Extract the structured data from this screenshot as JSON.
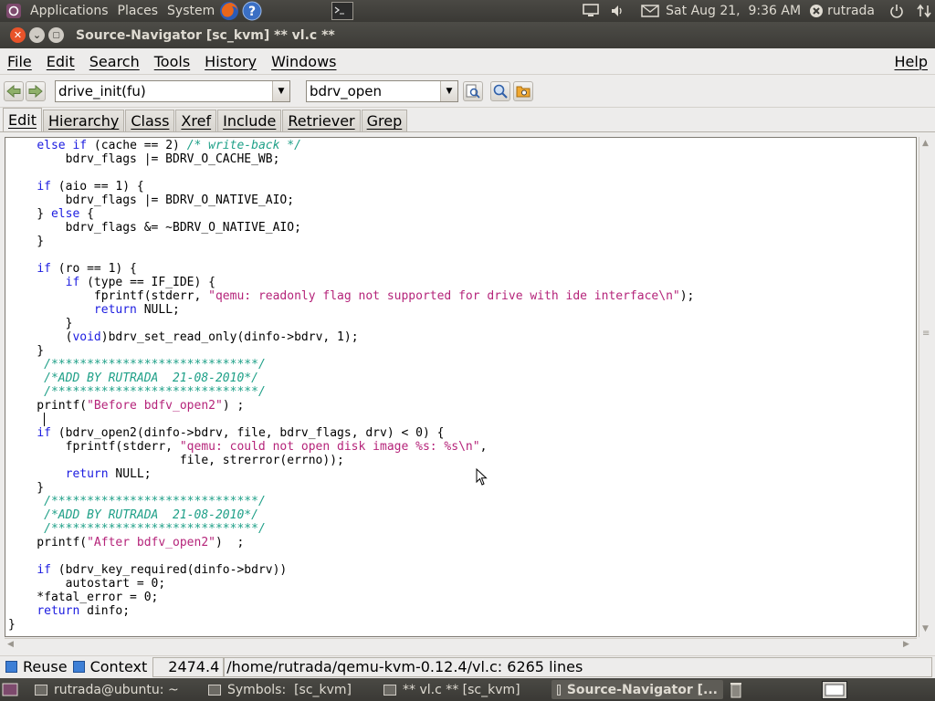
{
  "panel": {
    "menus": [
      "Applications",
      "Places",
      "System"
    ],
    "datetime": "Sat Aug 21,  9:36 AM",
    "user": "rutrada"
  },
  "window": {
    "title": "Source-Navigator [sc_kvm] ** vl.c **"
  },
  "menubar": {
    "items": [
      "File",
      "Edit",
      "Search",
      "Tools",
      "History",
      "Windows"
    ],
    "help": "Help"
  },
  "toolbar": {
    "symbol_combo": "drive_init(fu)",
    "search_combo": "bdrv_open"
  },
  "tabs": [
    "Edit",
    "Hierarchy",
    "Class",
    "Xref",
    "Include",
    "Retriever",
    "Grep"
  ],
  "active_tab": "Edit",
  "code_lines": [
    [
      [
        "    ",
        ""
      ],
      [
        "else if",
        "kw"
      ],
      [
        " (cache == 2) ",
        ""
      ],
      [
        "/* write-back */",
        "com"
      ]
    ],
    [
      [
        "        bdrv_flags |= BDRV_O_CACHE_WB;",
        ""
      ]
    ],
    [
      [
        "",
        ""
      ]
    ],
    [
      [
        "    ",
        ""
      ],
      [
        "if",
        "kw"
      ],
      [
        " (aio == 1) {",
        ""
      ]
    ],
    [
      [
        "        bdrv_flags |= BDRV_O_NATIVE_AIO;",
        ""
      ]
    ],
    [
      [
        "    } ",
        ""
      ],
      [
        "else",
        "kw"
      ],
      [
        " {",
        ""
      ]
    ],
    [
      [
        "        bdrv_flags &= ~BDRV_O_NATIVE_AIO;",
        ""
      ]
    ],
    [
      [
        "    }",
        ""
      ]
    ],
    [
      [
        "",
        ""
      ]
    ],
    [
      [
        "    ",
        ""
      ],
      [
        "if",
        "kw"
      ],
      [
        " (ro == 1) {",
        ""
      ]
    ],
    [
      [
        "        ",
        ""
      ],
      [
        "if",
        "kw"
      ],
      [
        " (type == IF_IDE) {",
        ""
      ]
    ],
    [
      [
        "            fprintf(stderr, ",
        ""
      ],
      [
        "\"qemu: readonly flag not supported for drive with ide interface\\n\"",
        "str"
      ],
      [
        ");",
        ""
      ]
    ],
    [
      [
        "            ",
        ""
      ],
      [
        "return",
        "kw"
      ],
      [
        " NULL;",
        ""
      ]
    ],
    [
      [
        "        }",
        ""
      ]
    ],
    [
      [
        "        (",
        ""
      ],
      [
        "void",
        "kw"
      ],
      [
        ")bdrv_set_read_only(dinfo->bdrv, 1);",
        ""
      ]
    ],
    [
      [
        "    }",
        ""
      ]
    ],
    [
      [
        "     ",
        ""
      ],
      [
        "/*****************************/",
        "com"
      ]
    ],
    [
      [
        "     ",
        ""
      ],
      [
        "/*ADD BY RUTRADA  21-08-2010*/",
        "com"
      ]
    ],
    [
      [
        "     ",
        ""
      ],
      [
        "/*****************************/",
        "com"
      ]
    ],
    [
      [
        "    printf(",
        ""
      ],
      [
        "\"Before bdfv_open2\"",
        "str"
      ],
      [
        ") ;",
        ""
      ]
    ],
    [
      [
        "",
        ""
      ]
    ],
    [
      [
        "    ",
        ""
      ],
      [
        "if",
        "kw"
      ],
      [
        " (bdrv_open2(dinfo->bdrv, file, bdrv_flags, drv) < 0) {",
        ""
      ]
    ],
    [
      [
        "        fprintf(stderr, ",
        ""
      ],
      [
        "\"qemu: could not open disk image %s: %s\\n\"",
        "str"
      ],
      [
        ",",
        ""
      ]
    ],
    [
      [
        "                        file, strerror(errno));",
        ""
      ]
    ],
    [
      [
        "        ",
        ""
      ],
      [
        "return",
        "kw"
      ],
      [
        " NULL;",
        ""
      ]
    ],
    [
      [
        "    }",
        ""
      ]
    ],
    [
      [
        "     ",
        ""
      ],
      [
        "/*****************************/",
        "com"
      ]
    ],
    [
      [
        "     ",
        ""
      ],
      [
        "/*ADD BY RUTRADA  21-08-2010*/",
        "com"
      ]
    ],
    [
      [
        "     ",
        ""
      ],
      [
        "/*****************************/",
        "com"
      ]
    ],
    [
      [
        "    printf(",
        ""
      ],
      [
        "\"After bdfv_open2\"",
        "str"
      ],
      [
        ")  ;",
        ""
      ]
    ],
    [
      [
        "",
        ""
      ]
    ],
    [
      [
        "    ",
        ""
      ],
      [
        "if",
        "kw"
      ],
      [
        " (bdrv_key_required(dinfo->bdrv))",
        ""
      ]
    ],
    [
      [
        "        autostart = 0;",
        ""
      ]
    ],
    [
      [
        "    *fatal_error = 0;",
        ""
      ]
    ],
    [
      [
        "    ",
        ""
      ],
      [
        "return",
        "kw"
      ],
      [
        " dinfo;",
        ""
      ]
    ],
    [
      [
        "}",
        ""
      ]
    ]
  ],
  "statusbar": {
    "reuse": "Reuse",
    "context": "Context",
    "position": "2474.4",
    "file_info": "/home/rutrada/qemu-kvm-0.12.4/vl.c: 6265 lines"
  },
  "taskbar": {
    "tasks": [
      "rutrada@ubuntu: ~",
      "Symbols:  [sc_kvm]",
      "** vl.c ** [sc_kvm]",
      "Source-Navigator [..."
    ],
    "active_index": 3
  },
  "colors": {
    "keyword": "#1c1ce0",
    "string": "#b5247a",
    "comment": "#1fa088",
    "panel": "#3c3b37",
    "close_button": "#e8532a"
  }
}
